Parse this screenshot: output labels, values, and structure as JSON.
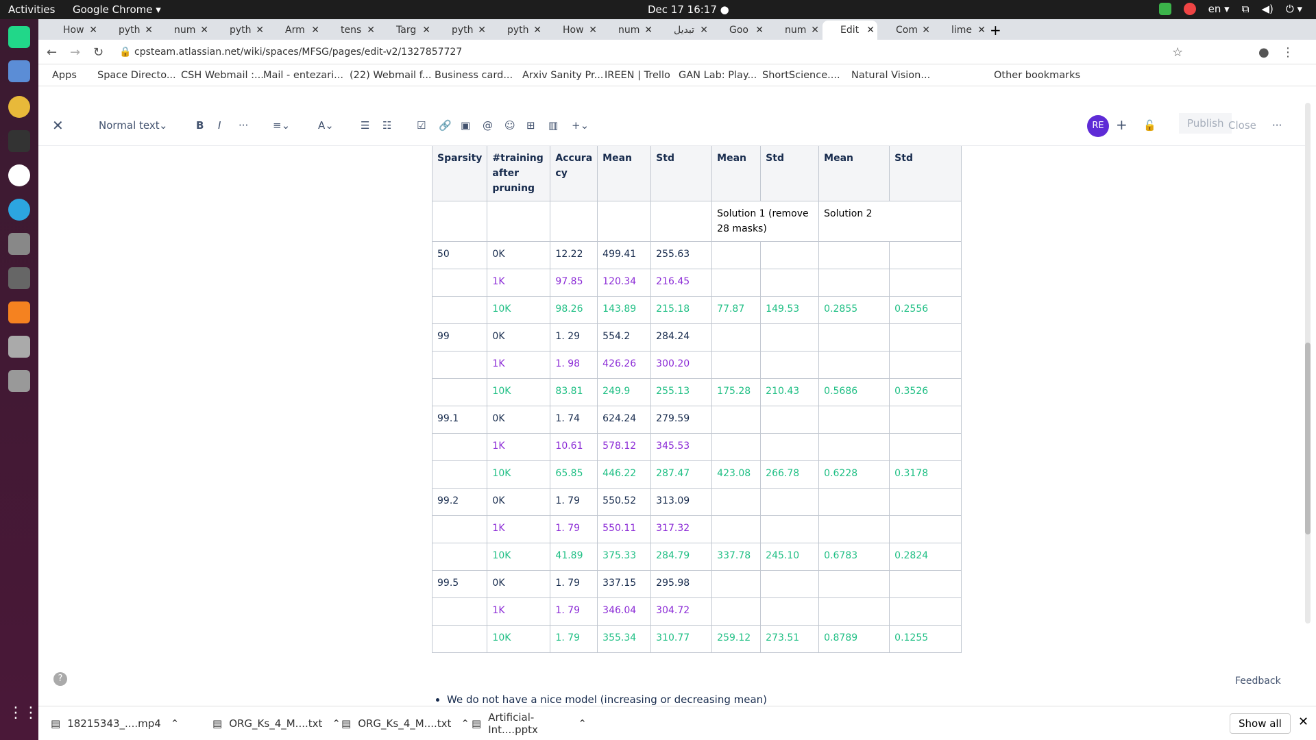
{
  "system": {
    "activities": "Activities",
    "app": "Google Chrome ▾",
    "clock": "Dec 17  16:17 ●",
    "lang": "en ▾"
  },
  "tabs": [
    "How",
    "pyth",
    "num",
    "pyth",
    "Arm",
    "tens",
    "Targ",
    "pyth",
    "pyth",
    "How",
    "num",
    "تبدیل",
    "Goo",
    "num",
    "Edit",
    "Com",
    "lime"
  ],
  "url": "cpsteam.atlassian.net/wiki/spaces/MFSG/pages/edit-v2/1327857727",
  "bookmarks": [
    "Apps",
    "Space Directo...",
    "CSH Webmail :...",
    "Mail - entezari...",
    "(22) Webmail f...",
    "Business card...",
    "Arxiv Sanity Pr...",
    "IREEN | Trello",
    "GAN Lab: Play...",
    "ShortScience....",
    "Natural Vision...",
    "Other bookmarks"
  ],
  "editor": {
    "style": "Normal text",
    "publish": "Publish",
    "close": "Close",
    "avatar": "RE",
    "feedback": "Feedback"
  },
  "table": {
    "headers": [
      "Sparsity",
      "#training after pruning",
      "Accura cy",
      "Mean",
      "Std",
      "Mean",
      "Std",
      "Mean",
      "Std"
    ],
    "solution1": "Solution 1 (remove 28 masks)",
    "solution2": "Solution 2",
    "rows": [
      [
        "50",
        "0K",
        "12.22",
        "499.41",
        "255.63",
        "",
        "",
        "",
        ""
      ],
      [
        "",
        "1K",
        "97.85",
        "120.34",
        "216.45",
        "",
        "",
        "",
        ""
      ],
      [
        "",
        "10K",
        "98.26",
        "143.89",
        "215.18",
        "77.87",
        "149.53",
        "0.2855",
        "0.2556"
      ],
      [
        "99",
        "0K",
        "1. 29",
        "554.2",
        "284.24",
        "",
        "",
        "",
        ""
      ],
      [
        "",
        "1K",
        "1. 98",
        "426.26",
        "300.20",
        "",
        "",
        "",
        ""
      ],
      [
        "",
        "10K",
        "83.81",
        "249.9",
        "255.13",
        "175.28",
        "210.43",
        "0.5686",
        "0.3526"
      ],
      [
        "99.1",
        "0K",
        "1. 74",
        "624.24",
        "279.59",
        "",
        "",
        "",
        ""
      ],
      [
        "",
        "1K",
        "10.61",
        "578.12",
        "345.53",
        "",
        "",
        "",
        ""
      ],
      [
        "",
        "10K",
        "65.85",
        "446.22",
        "287.47",
        "423.08",
        "266.78",
        "0.6228",
        "0.3178"
      ],
      [
        "99.2",
        "0K",
        "1. 79",
        "550.52",
        "313.09",
        "",
        "",
        "",
        ""
      ],
      [
        "",
        "1K",
        "1. 79",
        "550.11",
        "317.32",
        "",
        "",
        "",
        ""
      ],
      [
        "",
        "10K",
        "41.89",
        "375.33",
        "284.79",
        "337.78",
        "245.10",
        "0.6783",
        "0.2824"
      ],
      [
        "99.5",
        "0K",
        "1. 79",
        "337.15",
        "295.98",
        "",
        "",
        "",
        ""
      ],
      [
        "",
        "1K",
        "1. 79",
        "346.04",
        "304.72",
        "",
        "",
        "",
        ""
      ],
      [
        "",
        "10K",
        "1. 79",
        "355.34",
        "310.77",
        "259.12",
        "273.51",
        "0.8789",
        "0.1255"
      ]
    ]
  },
  "bullet": "We do not have a nice model (increasing or decreasing mean)",
  "downloads": [
    "18215343_....mp4",
    "ORG_Ks_4_M....txt",
    "ORG_Ks_4_M....txt",
    "Artificial-Int....pptx"
  ],
  "show_all": "Show all"
}
